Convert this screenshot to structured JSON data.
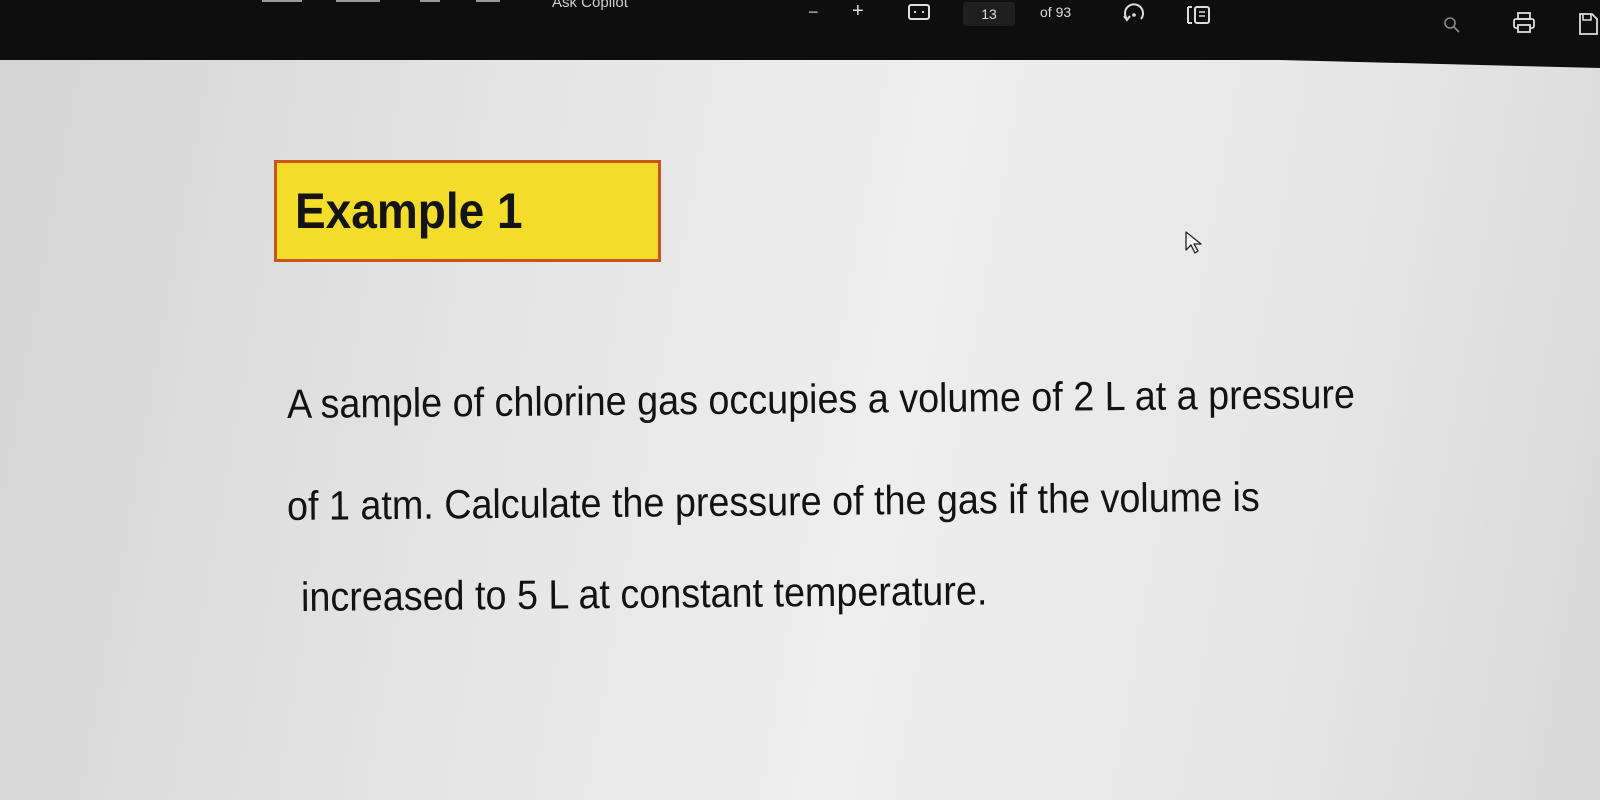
{
  "toolbar": {
    "copilot_label": "Ask Copilot",
    "zoom_out_label": "−",
    "zoom_in_label": "+",
    "page_current": "13",
    "page_total": "of 93"
  },
  "icons": {
    "fit": "fit-page-icon",
    "rotate": "rotate-icon",
    "view": "page-view-icon",
    "search": "search-icon",
    "print": "print-icon",
    "save": "save-icon",
    "cursor": "mouse-cursor-icon"
  },
  "slide": {
    "title": "Example 1",
    "lines": [
      "A sample of chlorine gas occupies a volume of 2 L at a pressure",
      "of 1 atm. Calculate the pressure of the gas  if the volume is",
      "increased to 5 L at constant temperature."
    ]
  },
  "colors": {
    "title_bg": "#f4dc2a",
    "title_border": "#c9541e",
    "toolbar_bg": "#0e0e0e"
  }
}
